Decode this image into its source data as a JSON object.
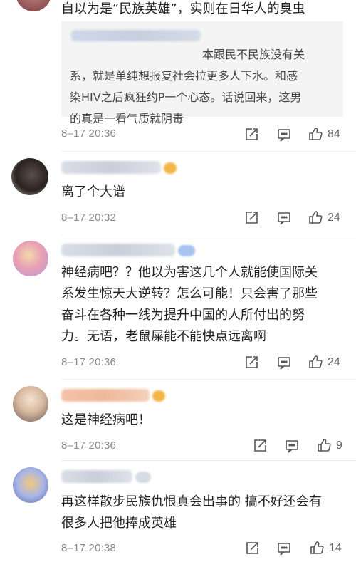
{
  "comments": [
    {
      "text": "自以为是“民族英雄”，实则在日华人的臭虫",
      "quote": {
        "first_line": "本跟民不民族没有关",
        "rest": "系，就是单纯想报复社会拉更多人下水。和感\n染HIV之后疯狂约P一个心态。话说回来，这男\n的真是一看气质就阴毒"
      },
      "time": "8–17 20:36",
      "likes": "84"
    },
    {
      "text": "离了个大谱",
      "time": "8–17 20:32",
      "likes": "24"
    },
    {
      "text": "神经病吧？？他以为害这几个人就能使国际关\n系发生惊天大逆转？怎么可能！只会害了那些\n奋斗在各种一线为提升中国的人所付出的努\n力。无语，老鼠屎能不能快点远离啊",
      "time": "8–17 20:36",
      "likes": "24"
    },
    {
      "text": "这是神经病吧！",
      "time": "8–17 20:36",
      "likes": "9"
    },
    {
      "text": "再这样散步民族仇恨真会出事的 搞不好还会有\n很多人把他捧成英雄",
      "time": "8–17 20:38",
      "likes": "14"
    }
  ],
  "icons": {
    "share": "share-icon",
    "reply": "comment-icon",
    "like": "thumbs-up-icon"
  },
  "colors": {
    "text": "#222222",
    "meta": "#8a8a8a",
    "quote_bg": "#f4f4f4",
    "icon": "#555555"
  }
}
